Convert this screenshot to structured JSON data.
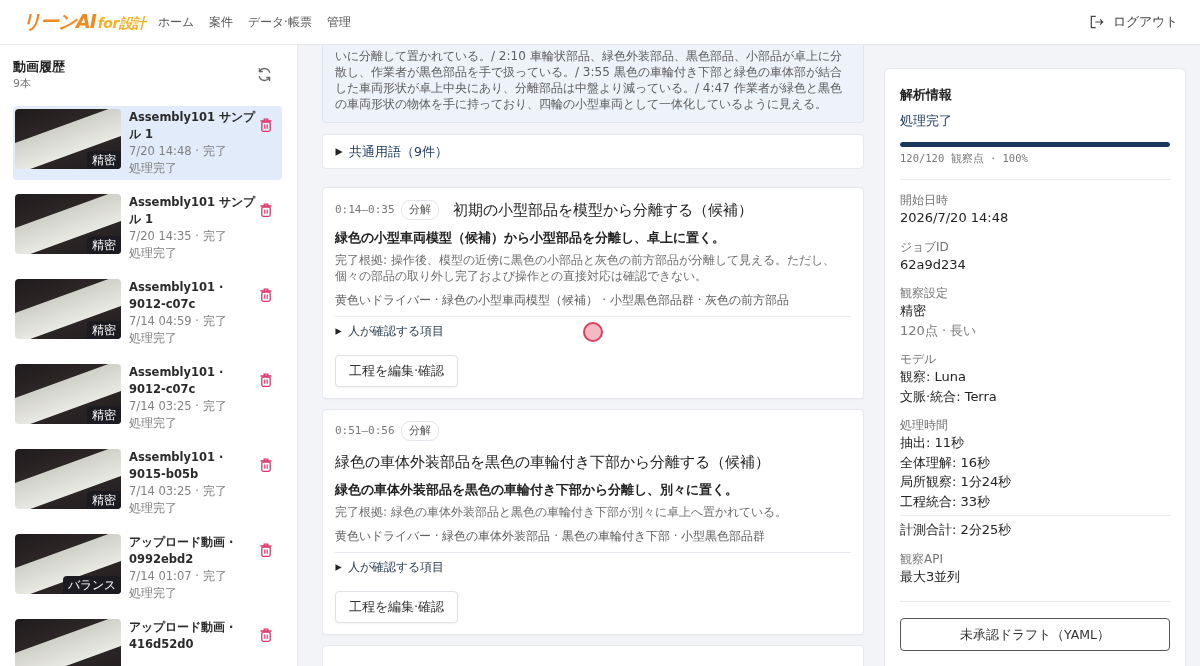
{
  "header": {
    "logo": {
      "name": "リーンAI",
      "suffix": "for設計"
    },
    "nav": [
      {
        "label": "ホーム"
      },
      {
        "label": "案件"
      },
      {
        "label": "データ·帳票"
      },
      {
        "label": "管理"
      }
    ],
    "logout": "ログアウト"
  },
  "sidebar": {
    "title": "動画履歴",
    "count": "9本",
    "videos": [
      {
        "title": "Assembly101 サンプル 1",
        "time": "7/20 14:48 · 完了",
        "status": "処理完了",
        "badge": "精密",
        "selected": true
      },
      {
        "title": "Assembly101 サンプル 1",
        "time": "7/20 14:35 · 完了",
        "status": "処理完了",
        "badge": "精密",
        "selected": false
      },
      {
        "title": "Assembly101 · 9012-c07c",
        "time": "7/14 04:59 · 完了",
        "status": "処理完了",
        "badge": "精密",
        "selected": false
      },
      {
        "title": "Assembly101 · 9012-c07c",
        "time": "7/14 03:25 · 完了",
        "status": "処理完了",
        "badge": "精密",
        "selected": false
      },
      {
        "title": "Assembly101 · 9015-b05b",
        "time": "7/14 03:25 · 完了",
        "status": "処理完了",
        "badge": "精密",
        "selected": false
      },
      {
        "title": "アップロード動画 · 0992ebd2",
        "time": "7/14 01:07 · 完了",
        "status": "処理完了",
        "badge": "バランス",
        "selected": false
      },
      {
        "title": "アップロード動画 · 416d52d0",
        "selected": false
      }
    ]
  },
  "summary": {
    "text": "いに分離して置かれている。/ 2:10 車輪状部品、緑色外装部品、黒色部品、小部品が卓上に分散し、作業者が黒色部品を手で扱っている。/ 3:55 黒色の車輪付き下部と緑色の車体部が結合した車両形状が卓上中央にあり、分離部品は中盤より減っている。/ 4:47 作業者が緑色と黒色の車両形状の物体を手に持っており、四輪の小型車両として一体化しているように見える。"
  },
  "glossary": {
    "label": "共通用語（9件）",
    "expanded": false
  },
  "steps": [
    {
      "time": "0:14–0:35",
      "type": "分解",
      "title": "初期の小型部品を模型から分離する（候補）",
      "action": "緑色の小型車両模型（候補）から小型部品を分離し、卓上に置く。",
      "evidence": "完了根拠: 操作後、模型の近傍に黒色の小部品と灰色の前方部品が分離して見える。ただし、個々の部品の取り外し完了および操作との直接対応は確認できない。",
      "tools": "黄色いドライバー · 緑色の小型車両模型（候補） · 小型黒色部品群 · 灰色の前方部品",
      "review": {
        "label": "人が確認する項目",
        "expanded": false
      },
      "button": "工程を編集·確認"
    },
    {
      "time": "0:51–0:56",
      "type": "分解",
      "title": "緑色の車体外装部品を黒色の車輪付き下部から分離する（候補）",
      "action": "緑色の車体外装部品を黒色の車輪付き下部から分離し、別々に置く。",
      "evidence": "完了根拠: 緑色の車体外装部品と黒色の車輪付き下部が別々に卓上へ置かれている。",
      "tools": "黄色いドライバー · 緑色の車体外装部品 · 黒色の車輪付き下部 · 小型黒色部品群",
      "review": {
        "label": "人が確認する項目",
        "expanded": false
      },
      "button": "工程を編集·確認"
    }
  ],
  "info": {
    "title": "解析情報",
    "status": "処理完了",
    "progress": {
      "level": 1,
      "caption": "120/120 観察点 · 100%"
    },
    "fields": [
      {
        "label": "開始日時",
        "values": [
          "2026/7/20 14:48"
        ]
      },
      {
        "label": "ジョブID",
        "values": [
          "62a9d234"
        ]
      },
      {
        "label": "観察設定",
        "values": [
          "精密"
        ],
        "note": "120点 · 長い"
      },
      {
        "label": "モデル",
        "values": [
          "観察: Luna",
          "文脈·統合: Terra"
        ]
      },
      {
        "label": "処理時間",
        "values": [
          "抽出: 11秒",
          "全体理解: 16秒",
          "局所観察: 1分24秒",
          "工程統合: 33秒"
        ],
        "total": "計測合計: 2分25秒"
      },
      {
        "label": "観察API",
        "values": [
          "最大3並列"
        ]
      }
    ],
    "button": "未承認ドラフト（YAML）"
  }
}
